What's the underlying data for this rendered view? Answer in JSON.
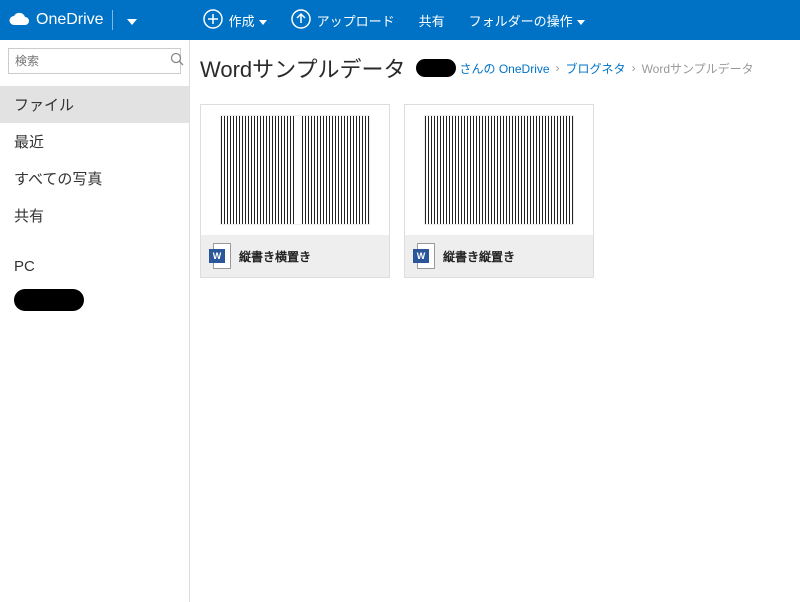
{
  "brand": {
    "name": "OneDrive"
  },
  "toolbar": {
    "create": "作成",
    "upload": "アップロード",
    "share": "共有",
    "folder_ops": "フォルダーの操作"
  },
  "search": {
    "placeholder": "検索"
  },
  "sidebar": {
    "items": [
      {
        "label": "ファイル",
        "active": true
      },
      {
        "label": "最近",
        "active": false
      },
      {
        "label": "すべての写真",
        "active": false
      },
      {
        "label": "共有",
        "active": false
      }
    ],
    "pc_label": "PC"
  },
  "page": {
    "title": "Wordサンプルデータ",
    "breadcrumb": {
      "owner_suffix": "さんの OneDrive",
      "crumb1": "ブログネタ",
      "current": "Wordサンプルデータ"
    }
  },
  "files": [
    {
      "name": "縦書き横置き",
      "icon_letter": "W",
      "style": "two-col"
    },
    {
      "name": "縦書き縦置き",
      "icon_letter": "W",
      "style": "one-col"
    }
  ]
}
